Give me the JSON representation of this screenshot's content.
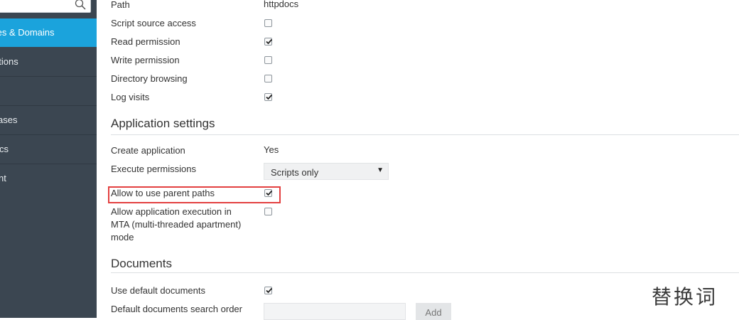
{
  "sidebar": {
    "search": {
      "placeholder": ""
    },
    "items": [
      {
        "label": "tes & Domains",
        "active": true
      },
      {
        "label": "ations"
      },
      {
        "label": ""
      },
      {
        "label": "ases"
      },
      {
        "label": "cs"
      },
      {
        "label": "nt"
      }
    ]
  },
  "form": {
    "path": {
      "label": "Path",
      "value": "httpdocs"
    },
    "script_source_access": {
      "label": "Script source access",
      "checked": false
    },
    "read_permission": {
      "label": "Read permission",
      "checked": true
    },
    "write_permission": {
      "label": "Write permission",
      "checked": false
    },
    "directory_browsing": {
      "label": "Directory browsing",
      "checked": false
    },
    "log_visits": {
      "label": "Log visits",
      "checked": true
    }
  },
  "application_settings": {
    "title": "Application settings",
    "create_application": {
      "label": "Create application",
      "value": "Yes"
    },
    "execute_permissions": {
      "label": "Execute permissions",
      "selected": "Scripts only"
    },
    "allow_parent_paths": {
      "label": "Allow to use parent paths",
      "checked": true
    },
    "allow_mta": {
      "label_line1": "Allow application execution in",
      "label_line2": "MTA (multi-threaded apartment)",
      "label_line3": "mode",
      "checked": false
    }
  },
  "documents": {
    "title": "Documents",
    "use_default_documents": {
      "label": "Use default documents",
      "checked": true
    },
    "search_order": {
      "label": "Default documents search order",
      "value": "",
      "add_label": "Add"
    }
  },
  "watermark": "替换词",
  "colors": {
    "sidebar_bg": "#3b4651",
    "active_bg": "#1ba3dc",
    "highlight": "#e34040"
  }
}
